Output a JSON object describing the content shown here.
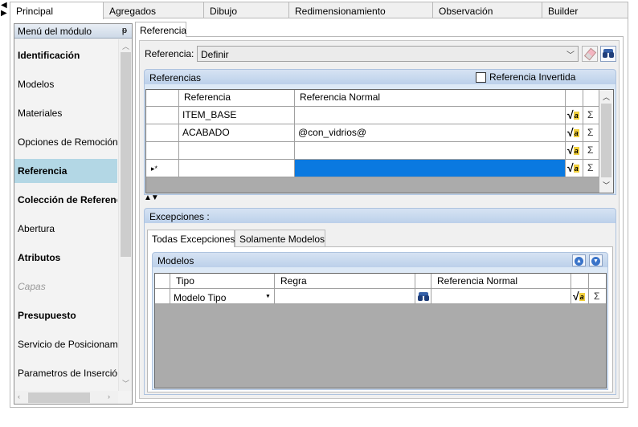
{
  "main_tabs": [
    "Principal",
    "Agregados",
    "Dibujo",
    "Redimensionamiento",
    "Observación",
    "Builder"
  ],
  "active_main_tab": "Principal",
  "menu": {
    "title": "Menú del módulo",
    "items": [
      {
        "label": "Identificación",
        "style": "bold"
      },
      {
        "label": "Modelos",
        "style": "normal"
      },
      {
        "label": "Materiales",
        "style": "normal"
      },
      {
        "label": "Opciones de Remoción",
        "style": "normal"
      },
      {
        "label": "Referencia",
        "style": "selected"
      },
      {
        "label": "Colección de Referencias",
        "style": "bold"
      },
      {
        "label": "Abertura",
        "style": "normal"
      },
      {
        "label": "Atributos",
        "style": "bold"
      },
      {
        "label": "Capas",
        "style": "disabled"
      },
      {
        "label": "Presupuesto",
        "style": "bold"
      },
      {
        "label": "Servicio de Posicionamiento",
        "style": "normal"
      },
      {
        "label": "Parametros de Inserción",
        "style": "normal"
      }
    ]
  },
  "subtab": "Referencia",
  "referencia": {
    "label": "Referencia:",
    "selected": "Definir"
  },
  "referencias_panel": {
    "title": "Referencias",
    "invertida_label": "Referencia Invertida",
    "invertida_checked": false,
    "columns": [
      "Referencia",
      "Referencia Normal"
    ],
    "rows": [
      {
        "indicator": "",
        "referencia": "ITEM_BASE",
        "normal": ""
      },
      {
        "indicator": "",
        "referencia": "ACABADO",
        "normal": "@con_vidrios@"
      },
      {
        "indicator": "",
        "referencia": "",
        "normal": ""
      },
      {
        "indicator": "▸*",
        "referencia": "",
        "normal": "",
        "selected": true
      }
    ]
  },
  "excepciones": {
    "title": "Excepciones :",
    "tabs": [
      "Todas Excepciones",
      "Solamente Modelos"
    ],
    "active_tab": "Todas Excepciones",
    "modelos": {
      "title": "Modelos",
      "columns": [
        "Tipo",
        "Regra",
        "Referencia Normal"
      ],
      "row": {
        "tipo": "Modelo Tipo",
        "regra": "",
        "normal": ""
      }
    }
  },
  "icons": {
    "formula": "√a",
    "sigma": "Σ"
  },
  "colors": {
    "selected_cell": "#0a79e0",
    "menu_selected": "#b3d7e5",
    "panel_header": "#bcd0ea"
  }
}
